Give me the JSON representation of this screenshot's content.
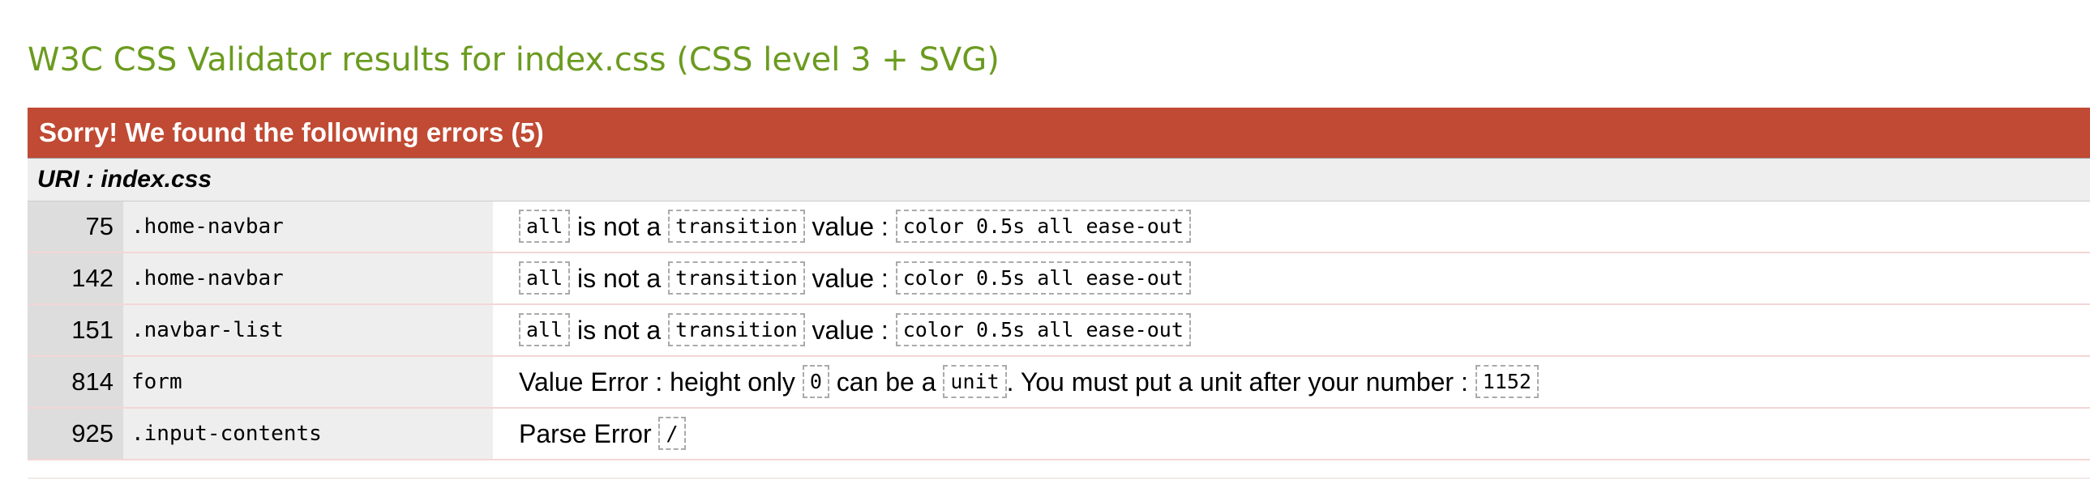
{
  "page": {
    "title": "W3C CSS Validator results for index.css (CSS level 3 + SVG)"
  },
  "errors_section": {
    "header": "Sorry! We found the following errors (5)",
    "uri_label": "URI : index.css",
    "rows": [
      {
        "line": "75",
        "context": ".home-navbar",
        "msg": {
          "c1": "all",
          "t1": " is not a ",
          "c2": "transition",
          "t2": " value : ",
          "c3": "color 0.5s all ease-out"
        }
      },
      {
        "line": "142",
        "context": ".home-navbar",
        "msg": {
          "c1": "all",
          "t1": " is not a ",
          "c2": "transition",
          "t2": " value : ",
          "c3": "color 0.5s all ease-out"
        }
      },
      {
        "line": "151",
        "context": ".navbar-list",
        "msg": {
          "c1": "all",
          "t1": " is not a ",
          "c2": "transition",
          "t2": " value : ",
          "c3": "color 0.5s all ease-out"
        }
      },
      {
        "line": "814",
        "context": "form",
        "msg": {
          "t1": "Value Error : height only ",
          "c1": "0",
          "t2": " can be a ",
          "c2": "unit",
          "t3": ". You must put a unit after your number : ",
          "c3": "1152"
        }
      },
      {
        "line": "925",
        "context": ".input-contents",
        "msg": {
          "t1": "Parse Error ",
          "c1": "/"
        }
      }
    ]
  },
  "colors": {
    "title_green": "#6b9b1f",
    "error_header_red": "#c04a33",
    "line_cell_gray": "#dddddd",
    "context_cell_gray": "#eeeeee"
  }
}
